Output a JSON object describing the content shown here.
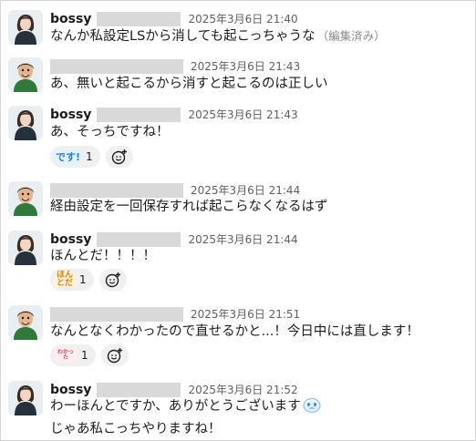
{
  "messages": [
    {
      "author": "bossy",
      "author_kind": "woman",
      "timestamp": "2025年3月6日 21:40",
      "lines": [
        "なんか私設定LSから消しても起こっちゃうな"
      ],
      "edited_label": "（編集済み）"
    },
    {
      "author": "",
      "author_kind": "man",
      "timestamp": "2025年3月6日 21:43",
      "lines": [
        "あ、無いと起こるから消すと起こるのは正しい"
      ]
    },
    {
      "author": "bossy",
      "author_kind": "woman",
      "timestamp": "2025年3月6日 21:43",
      "lines": [
        "あ、そっちですね！"
      ],
      "reaction": {
        "emoji_icon": "desu-stamp-icon",
        "stamp_text": "です!",
        "count": "1"
      }
    },
    {
      "author": "",
      "author_kind": "man",
      "timestamp": "2025年3月6日 21:44",
      "lines": [
        "経由設定を一回保存すれば起こらなくなるはず"
      ]
    },
    {
      "author": "bossy",
      "author_kind": "woman",
      "timestamp": "2025年3月6日 21:44",
      "lines": [
        "ほんとだ！！！！"
      ],
      "reaction": {
        "emoji_icon": "hontoda-stamp-icon",
        "stamp_text": "ほんとだ",
        "count": "1"
      }
    },
    {
      "author": "",
      "author_kind": "man",
      "timestamp": "2025年3月6日 21:51",
      "lines": [
        "なんとなくわかったので直せるかと...！今日中には直します！"
      ],
      "reaction": {
        "emoji_icon": "wakatta-stamp-icon",
        "stamp_text": "わかった",
        "count": "1"
      }
    },
    {
      "author": "bossy",
      "author_kind": "woman",
      "timestamp": "2025年3月6日 21:52",
      "lines": [
        "わーほんとですか、ありがとうございます",
        "じゃあ私こっちやりますね！"
      ],
      "inline_emoji": "teary-face-icon"
    }
  ],
  "colors": {
    "text": "#1d1c1d",
    "timestamp": "#616061",
    "edited": "#8a8a8a",
    "redaction": "#d9d9d9",
    "reaction_bg": "#f0f0f0"
  }
}
